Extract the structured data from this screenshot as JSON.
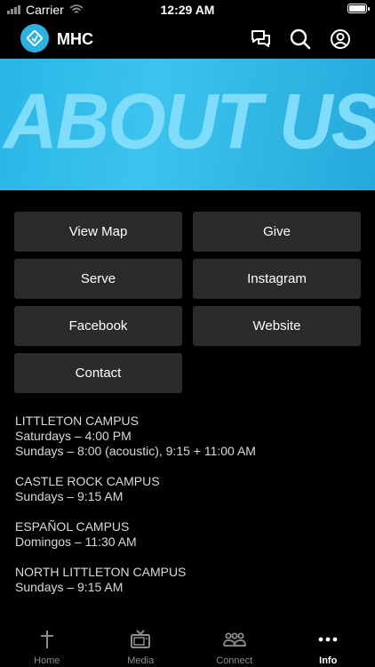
{
  "status_bar": {
    "carrier": "Carrier",
    "time": "12:29 AM"
  },
  "header": {
    "title": "MHC"
  },
  "banner": {
    "text": "ABOUT US"
  },
  "buttons": [
    "View Map",
    "Give",
    "Serve",
    "Instagram",
    "Facebook",
    "Website",
    "Contact"
  ],
  "campuses": [
    {
      "name": "LITTLETON CAMPUS",
      "lines": [
        "Saturdays – 4:00 PM",
        "Sundays – 8:00 (acoustic), 9:15 + 11:00 AM"
      ]
    },
    {
      "name": "CASTLE ROCK CAMPUS",
      "lines": [
        "Sundays – 9:15 AM"
      ]
    },
    {
      "name": "ESPAÑOL CAMPUS",
      "lines": [
        "Domingos – 11:30 AM"
      ]
    },
    {
      "name": "NORTH LITTLETON CAMPUS",
      "lines": [
        "Sundays – 9:15 AM"
      ]
    }
  ],
  "tabs": [
    {
      "label": "Home",
      "icon": "cross-icon",
      "active": false
    },
    {
      "label": "Media",
      "icon": "tv-icon",
      "active": false
    },
    {
      "label": "Connect",
      "icon": "group-icon",
      "active": false
    },
    {
      "label": "Info",
      "icon": "more-icon",
      "active": true
    }
  ],
  "colors": {
    "accent": "#2bb2e0",
    "button_bg": "#2b2b2b",
    "background": "#000000"
  }
}
